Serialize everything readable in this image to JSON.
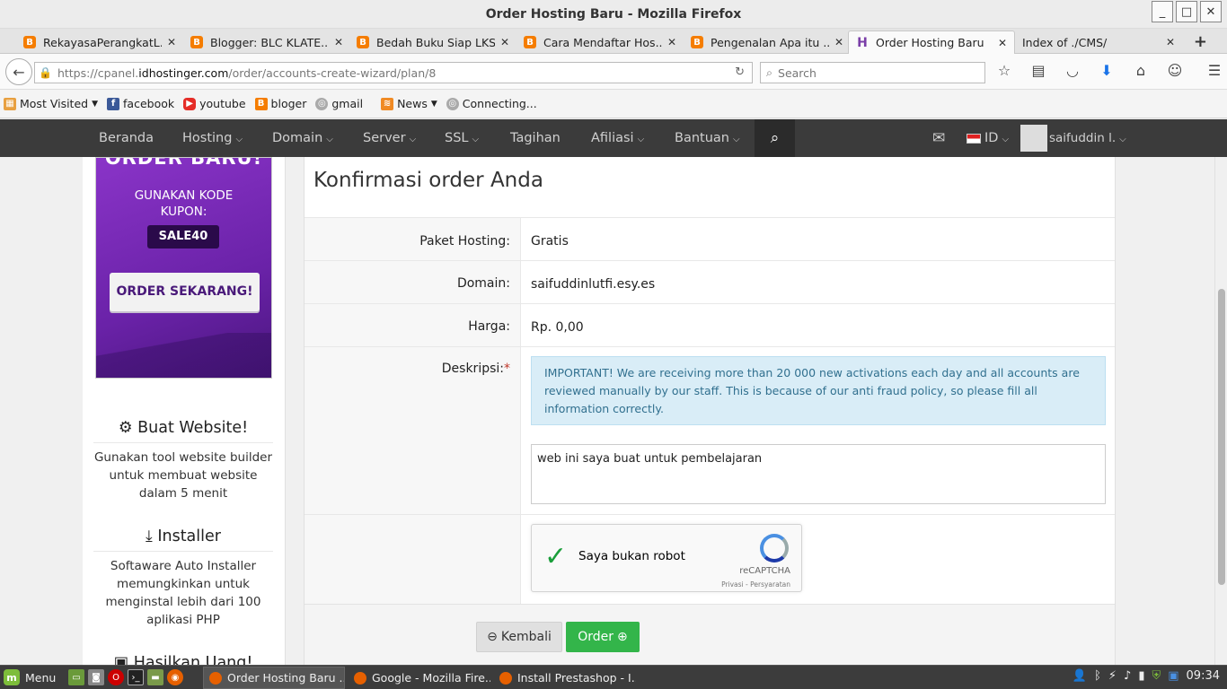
{
  "window": {
    "title": "Order Hosting Baru - Mozilla Firefox",
    "minimize": "_",
    "maximize": "□",
    "close": "✕"
  },
  "tabs": [
    {
      "label": "RekayasaPerangkatL...",
      "icon": "blogger-icon",
      "glyph": "B"
    },
    {
      "label": "Blogger: BLC KLATE...",
      "icon": "blogger-icon",
      "glyph": "B"
    },
    {
      "label": "Bedah Buku Siap LKS...",
      "icon": "blogger-icon",
      "glyph": "B"
    },
    {
      "label": "Cara Mendaftar Hos...",
      "icon": "blogger-icon",
      "glyph": "B"
    },
    {
      "label": "Pengenalan Apa itu ...",
      "icon": "blogger-icon",
      "glyph": "B"
    },
    {
      "label": "Order Hosting Baru",
      "icon": "hostinger-icon",
      "glyph": "H"
    },
    {
      "label": "Index of ./CMS/",
      "icon": "",
      "glyph": ""
    }
  ],
  "tab_close": "✕",
  "new_tab": "+",
  "navbar": {
    "url_prefix": "https://cpanel.",
    "url_domain": "idhostinger.com",
    "url_path": "/order/accounts-create-wizard/plan/8",
    "search_placeholder": "Search"
  },
  "bookmarks": [
    {
      "label": "Most Visited",
      "icon": "most-visited-icon",
      "dropdown": true
    },
    {
      "label": "facebook",
      "icon": "facebook-icon"
    },
    {
      "label": "youtube",
      "icon": "youtube-icon"
    },
    {
      "label": "bloger",
      "icon": "blogger-icon"
    },
    {
      "label": "gmail",
      "icon": "globe-icon"
    },
    {
      "label": "News",
      "icon": "rss-icon",
      "dropdown": true
    },
    {
      "label": "Connecting...",
      "icon": "globe-icon"
    }
  ],
  "sitenav": {
    "items": [
      "Beranda",
      "Hosting",
      "Domain",
      "Server",
      "SSL",
      "Tagihan",
      "Afiliasi",
      "Bantuan"
    ],
    "lang": "ID",
    "user": "saifuddin l."
  },
  "promo": {
    "headline": "ORDER BARU!",
    "coupon_intro": "GUNAKAN KODE KUPON:",
    "coupon_code": "SALE40",
    "cta": "ORDER SEKARANG!"
  },
  "features": [
    {
      "title": "Buat Website!",
      "icon": "gears-icon",
      "text": "Gunakan tool website builder untuk membuat website dalam 5 menit"
    },
    {
      "title": "Installer",
      "icon": "download-icon",
      "text": "Softaware Auto Installer memungkinkan untuk menginstal lebih dari 100 aplikasi PHP"
    },
    {
      "title": "Hasilkan Uang!",
      "icon": "money-icon",
      "text": ""
    }
  ],
  "order": {
    "title": "Konfirmasi order Anda",
    "paket_label": "Paket Hosting:",
    "paket_value": "Gratis",
    "domain_label": "Domain:",
    "domain_value": "saifuddinlutfi.esy.es",
    "harga_label": "Harga:",
    "harga_value": "Rp. 0,00",
    "deskripsi_label": "Deskripsi:",
    "required_mark": "*",
    "alert": "IMPORTANT! We are receiving more than 20 000 new activations each day and all accounts are reviewed manually by our staff. This is because of our anti fraud policy, so please fill all information correctly.",
    "description_value": "web ini saya buat untuk pembelajaran",
    "captcha_label": "Saya bukan robot",
    "captcha_brand": "reCAPTCHA",
    "captcha_privacy": "Privasi - Persyaratan",
    "back_button": "Kembali",
    "order_button": "Order"
  },
  "taskbar": {
    "menu": "Menu",
    "windows": [
      "Order Hosting Baru ...",
      "Google - Mozilla Fire...",
      "Install Prestashop - I..."
    ],
    "clock": "09:34"
  },
  "colors": {
    "accent_green": "#33b54a",
    "nav_dark": "#3b3b3b",
    "alert_bg": "#d9edf7",
    "promo_purple": "#7a2cba"
  }
}
